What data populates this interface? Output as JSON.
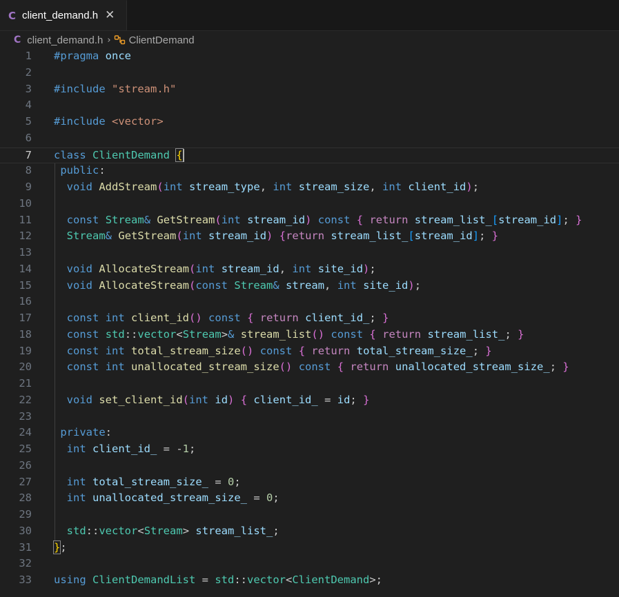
{
  "tab": {
    "icon_letter": "C",
    "label": "client_demand.h",
    "close": "✕"
  },
  "breadcrumb": {
    "icon_letter": "C",
    "file": "client_demand.h",
    "separator": "›",
    "symbol": "ClientDemand"
  },
  "editor": {
    "current_line": 7,
    "lines": [
      [
        [
          "pre",
          "#pragma"
        ],
        [
          "pl",
          " "
        ],
        [
          "var",
          "once"
        ]
      ],
      [],
      [
        [
          "pre",
          "#include"
        ],
        [
          "pl",
          " "
        ],
        [
          "str",
          "\"stream.h\""
        ]
      ],
      [],
      [
        [
          "pre",
          "#include"
        ],
        [
          "pl",
          " "
        ],
        [
          "str",
          "<vector>"
        ]
      ],
      [],
      [
        [
          "kw",
          "class"
        ],
        [
          "pl",
          " "
        ],
        [
          "ty",
          "ClientDemand"
        ],
        [
          "pl",
          " "
        ],
        [
          "p1b",
          "{"
        ]
      ],
      [
        [
          "pl",
          " "
        ],
        [
          "kw",
          "public"
        ],
        [
          "pl",
          ":"
        ]
      ],
      [
        [
          "pl",
          "  "
        ],
        [
          "kw",
          "void"
        ],
        [
          "pl",
          " "
        ],
        [
          "fn",
          "AddStream"
        ],
        [
          "p2",
          "("
        ],
        [
          "kw",
          "int"
        ],
        [
          "pl",
          " "
        ],
        [
          "var",
          "stream_type"
        ],
        [
          "pl",
          ", "
        ],
        [
          "kw",
          "int"
        ],
        [
          "pl",
          " "
        ],
        [
          "var",
          "stream_size"
        ],
        [
          "pl",
          ", "
        ],
        [
          "kw",
          "int"
        ],
        [
          "pl",
          " "
        ],
        [
          "var",
          "client_id"
        ],
        [
          "p2",
          ")"
        ],
        [
          "pl",
          ";"
        ]
      ],
      [],
      [
        [
          "pl",
          "  "
        ],
        [
          "kw",
          "const"
        ],
        [
          "pl",
          " "
        ],
        [
          "ty",
          "Stream"
        ],
        [
          "kw",
          "&"
        ],
        [
          "pl",
          " "
        ],
        [
          "fn",
          "GetStream"
        ],
        [
          "p2",
          "("
        ],
        [
          "kw",
          "int"
        ],
        [
          "pl",
          " "
        ],
        [
          "var",
          "stream_id"
        ],
        [
          "p2",
          ")"
        ],
        [
          "pl",
          " "
        ],
        [
          "kw",
          "const"
        ],
        [
          "pl",
          " "
        ],
        [
          "p2",
          "{"
        ],
        [
          "pl",
          " "
        ],
        [
          "ctl",
          "return"
        ],
        [
          "pl",
          " "
        ],
        [
          "var",
          "stream_list_"
        ],
        [
          "p3",
          "["
        ],
        [
          "var",
          "stream_id"
        ],
        [
          "p3",
          "]"
        ],
        [
          "pl",
          "; "
        ],
        [
          "p2",
          "}"
        ]
      ],
      [
        [
          "pl",
          "  "
        ],
        [
          "ty",
          "Stream"
        ],
        [
          "kw",
          "&"
        ],
        [
          "pl",
          " "
        ],
        [
          "fn",
          "GetStream"
        ],
        [
          "p2",
          "("
        ],
        [
          "kw",
          "int"
        ],
        [
          "pl",
          " "
        ],
        [
          "var",
          "stream_id"
        ],
        [
          "p2",
          ")"
        ],
        [
          "pl",
          " "
        ],
        [
          "p2",
          "{"
        ],
        [
          "ctl",
          "return"
        ],
        [
          "pl",
          " "
        ],
        [
          "var",
          "stream_list_"
        ],
        [
          "p3",
          "["
        ],
        [
          "var",
          "stream_id"
        ],
        [
          "p3",
          "]"
        ],
        [
          "pl",
          "; "
        ],
        [
          "p2",
          "}"
        ]
      ],
      [],
      [
        [
          "pl",
          "  "
        ],
        [
          "kw",
          "void"
        ],
        [
          "pl",
          " "
        ],
        [
          "fn",
          "AllocateStream"
        ],
        [
          "p2",
          "("
        ],
        [
          "kw",
          "int"
        ],
        [
          "pl",
          " "
        ],
        [
          "var",
          "stream_id"
        ],
        [
          "pl",
          ", "
        ],
        [
          "kw",
          "int"
        ],
        [
          "pl",
          " "
        ],
        [
          "var",
          "site_id"
        ],
        [
          "p2",
          ")"
        ],
        [
          "pl",
          ";"
        ]
      ],
      [
        [
          "pl",
          "  "
        ],
        [
          "kw",
          "void"
        ],
        [
          "pl",
          " "
        ],
        [
          "fn",
          "AllocateStream"
        ],
        [
          "p2",
          "("
        ],
        [
          "kw",
          "const"
        ],
        [
          "pl",
          " "
        ],
        [
          "ty",
          "Stream"
        ],
        [
          "kw",
          "&"
        ],
        [
          "pl",
          " "
        ],
        [
          "var",
          "stream"
        ],
        [
          "pl",
          ", "
        ],
        [
          "kw",
          "int"
        ],
        [
          "pl",
          " "
        ],
        [
          "var",
          "site_id"
        ],
        [
          "p2",
          ")"
        ],
        [
          "pl",
          ";"
        ]
      ],
      [],
      [
        [
          "pl",
          "  "
        ],
        [
          "kw",
          "const"
        ],
        [
          "pl",
          " "
        ],
        [
          "kw",
          "int"
        ],
        [
          "pl",
          " "
        ],
        [
          "fn",
          "client_id"
        ],
        [
          "p2",
          "()"
        ],
        [
          "pl",
          " "
        ],
        [
          "kw",
          "const"
        ],
        [
          "pl",
          " "
        ],
        [
          "p2",
          "{"
        ],
        [
          "pl",
          " "
        ],
        [
          "ctl",
          "return"
        ],
        [
          "pl",
          " "
        ],
        [
          "var",
          "client_id_"
        ],
        [
          "pl",
          "; "
        ],
        [
          "p2",
          "}"
        ]
      ],
      [
        [
          "pl",
          "  "
        ],
        [
          "kw",
          "const"
        ],
        [
          "pl",
          " "
        ],
        [
          "ty",
          "std"
        ],
        [
          "pl",
          "::"
        ],
        [
          "ty",
          "vector"
        ],
        [
          "pl",
          "<"
        ],
        [
          "ty",
          "Stream"
        ],
        [
          "pl",
          ">"
        ],
        [
          "kw",
          "&"
        ],
        [
          "pl",
          " "
        ],
        [
          "fn",
          "stream_list"
        ],
        [
          "p2",
          "()"
        ],
        [
          "pl",
          " "
        ],
        [
          "kw",
          "const"
        ],
        [
          "pl",
          " "
        ],
        [
          "p2",
          "{"
        ],
        [
          "pl",
          " "
        ],
        [
          "ctl",
          "return"
        ],
        [
          "pl",
          " "
        ],
        [
          "var",
          "stream_list_"
        ],
        [
          "pl",
          "; "
        ],
        [
          "p2",
          "}"
        ]
      ],
      [
        [
          "pl",
          "  "
        ],
        [
          "kw",
          "const"
        ],
        [
          "pl",
          " "
        ],
        [
          "kw",
          "int"
        ],
        [
          "pl",
          " "
        ],
        [
          "fn",
          "total_stream_size"
        ],
        [
          "p2",
          "()"
        ],
        [
          "pl",
          " "
        ],
        [
          "kw",
          "const"
        ],
        [
          "pl",
          " "
        ],
        [
          "p2",
          "{"
        ],
        [
          "pl",
          " "
        ],
        [
          "ctl",
          "return"
        ],
        [
          "pl",
          " "
        ],
        [
          "var",
          "total_stream_size_"
        ],
        [
          "pl",
          "; "
        ],
        [
          "p2",
          "}"
        ]
      ],
      [
        [
          "pl",
          "  "
        ],
        [
          "kw",
          "const"
        ],
        [
          "pl",
          " "
        ],
        [
          "kw",
          "int"
        ],
        [
          "pl",
          " "
        ],
        [
          "fn",
          "unallocated_stream_size"
        ],
        [
          "p2",
          "()"
        ],
        [
          "pl",
          " "
        ],
        [
          "kw",
          "const"
        ],
        [
          "pl",
          " "
        ],
        [
          "p2",
          "{"
        ],
        [
          "pl",
          " "
        ],
        [
          "ctl",
          "return"
        ],
        [
          "pl",
          " "
        ],
        [
          "var",
          "unallocated_stream_size_"
        ],
        [
          "pl",
          "; "
        ],
        [
          "p2",
          "}"
        ]
      ],
      [],
      [
        [
          "pl",
          "  "
        ],
        [
          "kw",
          "void"
        ],
        [
          "pl",
          " "
        ],
        [
          "fn",
          "set_client_id"
        ],
        [
          "p2",
          "("
        ],
        [
          "kw",
          "int"
        ],
        [
          "pl",
          " "
        ],
        [
          "var",
          "id"
        ],
        [
          "p2",
          ")"
        ],
        [
          "pl",
          " "
        ],
        [
          "p2",
          "{"
        ],
        [
          "pl",
          " "
        ],
        [
          "var",
          "client_id_"
        ],
        [
          "pl",
          " = "
        ],
        [
          "var",
          "id"
        ],
        [
          "pl",
          "; "
        ],
        [
          "p2",
          "}"
        ]
      ],
      [],
      [
        [
          "pl",
          " "
        ],
        [
          "kw",
          "private"
        ],
        [
          "pl",
          ":"
        ]
      ],
      [
        [
          "pl",
          "  "
        ],
        [
          "kw",
          "int"
        ],
        [
          "pl",
          " "
        ],
        [
          "var",
          "client_id_"
        ],
        [
          "pl",
          " = -"
        ],
        [
          "num",
          "1"
        ],
        [
          "pl",
          ";"
        ]
      ],
      [],
      [
        [
          "pl",
          "  "
        ],
        [
          "kw",
          "int"
        ],
        [
          "pl",
          " "
        ],
        [
          "var",
          "total_stream_size_"
        ],
        [
          "pl",
          " = "
        ],
        [
          "num",
          "0"
        ],
        [
          "pl",
          ";"
        ]
      ],
      [
        [
          "pl",
          "  "
        ],
        [
          "kw",
          "int"
        ],
        [
          "pl",
          " "
        ],
        [
          "var",
          "unallocated_stream_size_"
        ],
        [
          "pl",
          " = "
        ],
        [
          "num",
          "0"
        ],
        [
          "pl",
          ";"
        ]
      ],
      [],
      [
        [
          "pl",
          "  "
        ],
        [
          "ty",
          "std"
        ],
        [
          "pl",
          "::"
        ],
        [
          "ty",
          "vector"
        ],
        [
          "pl",
          "<"
        ],
        [
          "ty",
          "Stream"
        ],
        [
          "pl",
          "> "
        ],
        [
          "var",
          "stream_list_"
        ],
        [
          "pl",
          ";"
        ]
      ],
      [
        [
          "p1b",
          "}"
        ],
        [
          "pl",
          ";"
        ]
      ],
      [],
      [
        [
          "kw",
          "using"
        ],
        [
          "pl",
          " "
        ],
        [
          "ty",
          "ClientDemandList"
        ],
        [
          "pl",
          " = "
        ],
        [
          "ty",
          "std"
        ],
        [
          "pl",
          "::"
        ],
        [
          "ty",
          "vector"
        ],
        [
          "pl",
          "<"
        ],
        [
          "ty",
          "ClientDemand"
        ],
        [
          "pl",
          ">;"
        ]
      ]
    ]
  }
}
